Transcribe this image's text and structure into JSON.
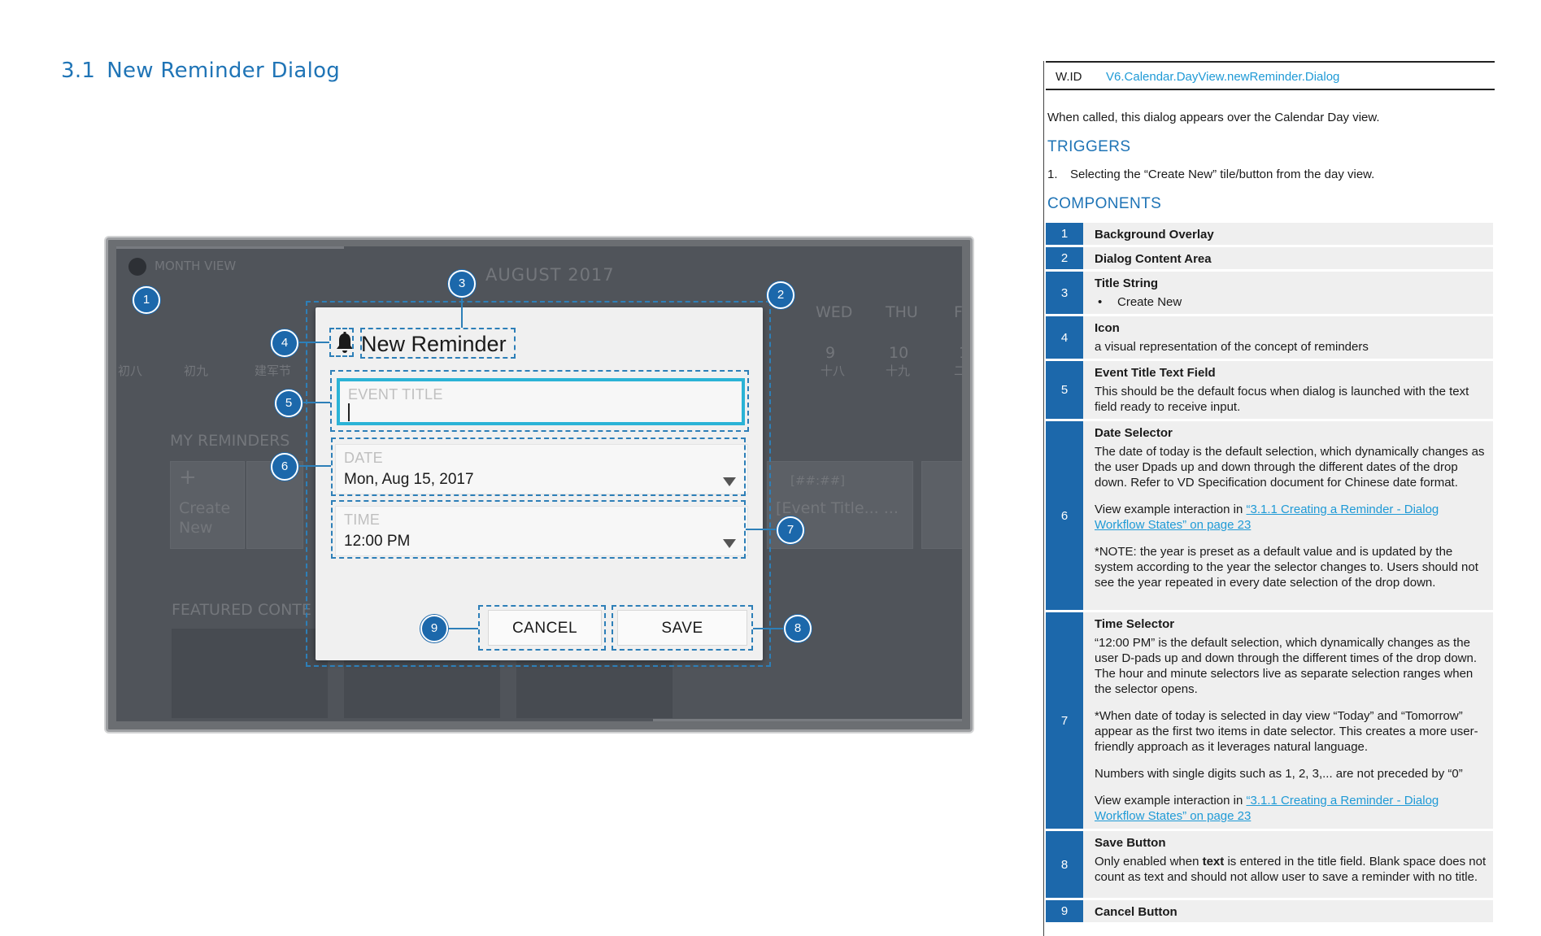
{
  "section": {
    "number": "3.1",
    "title": "New Reminder Dialog"
  },
  "tv": {
    "month_view": "MONTH VIEW",
    "month_title": "AUGUST 2017",
    "weekdays": [
      "WED",
      "THU",
      "F"
    ],
    "day_nums": [
      "9",
      "10",
      "1"
    ],
    "lunar_right": [
      "十八",
      "十九",
      "二"
    ],
    "lunar_left": [
      "初八",
      "初九",
      "建军节"
    ],
    "my_reminders": "MY REMINDERS",
    "create_plus": "+",
    "create_label_1": "Create",
    "create_label_2": "New",
    "event_tile_time": "[##:##]",
    "event_tile_title": "[Event Title... ...",
    "featured": "FEATURED CONTE"
  },
  "dialog": {
    "title": "New Reminder",
    "event_title_label": "EVENT TITLE",
    "date_label": "DATE",
    "date_value": "Mon, Aug 15, 2017",
    "time_label": "TIME",
    "time_value": "12:00 PM",
    "cancel": "CANCEL",
    "save": "SAVE"
  },
  "markers": [
    "1",
    "2",
    "3",
    "4",
    "5",
    "6",
    "7",
    "8",
    "9"
  ],
  "spec": {
    "wid_key": "W.ID",
    "wid_value": "V6.Calendar.DayView.newReminder.Dialog",
    "intro": "When called, this dialog appears over the Calendar Day view.",
    "triggers_heading": "TRIGGERS",
    "trigger_num": "1.",
    "trigger_text": "Selecting the “Create New” tile/button from the day view.",
    "components_heading": "COMPONENTS",
    "components": [
      {
        "no": "1",
        "title": "Background Overlay"
      },
      {
        "no": "2",
        "title": "Dialog Content Area"
      },
      {
        "no": "3",
        "title": "Title String",
        "bullet": "Create New"
      },
      {
        "no": "4",
        "title": "Icon",
        "desc": "a visual representation of the concept of reminders"
      },
      {
        "no": "5",
        "title": "Event Title Text Field",
        "desc": "This should be the default focus when dialog is launched with the text field ready to receive input."
      },
      {
        "no": "6",
        "title": "Date Selector",
        "desc": "The date of today is the default selection, which dynamically changes as the user Dpads up and down through the different dates of the drop down. Refer to VD Specification document for Chinese date format.",
        "link_prefix": "View example interaction in ",
        "link": "“3.1.1 Creating a Reminder - Dialog Workflow States” on page 23",
        "note": "*NOTE: the year is preset as a default value and is updated by the system according to the year the selector changes to. Users should not see the year repeated in every date selection of the drop down."
      },
      {
        "no": "7",
        "title": "Time Selector",
        "desc": "“12:00 PM” is the default selection, which dynamically changes as the user D-pads up and down through the different times of the drop down. The hour and minute selectors live as separate selection ranges when the selector opens.",
        "note": "*When date of today is selected in day view “Today” and “Tomorrow” appear as the first two items in date selector. This creates a more user-friendly approach as it leverages natural language.",
        "note2": "Numbers with single digits such as 1, 2, 3,... are not preceded by “0”",
        "link_prefix": "View example interaction in ",
        "link": "“3.1.1 Creating a Reminder - Dialog Workflow States” on page 23"
      },
      {
        "no": "8",
        "title": "Save Button",
        "desc_a": "Only enabled when ",
        "desc_bold": "text",
        "desc_b": " is entered in the title field. Blank space does not count as text and should not allow user to save a reminder with no title."
      },
      {
        "no": "9",
        "title": "Cancel Button"
      }
    ]
  },
  "colors": {
    "accent_blue": "#1f74b6",
    "marker_blue": "#1c68ab",
    "focus_cyan": "#2bb3d6",
    "link_blue": "#1f9ad6"
  }
}
